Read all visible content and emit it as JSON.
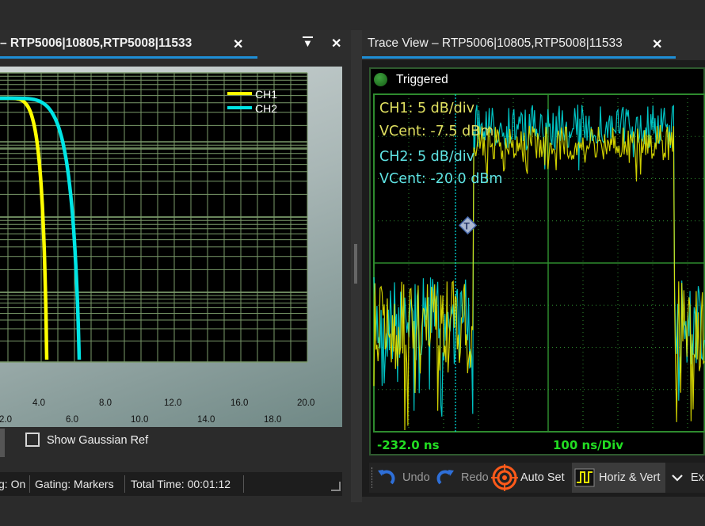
{
  "left_panel": {
    "tab_title": "– RTP5006|10805,RTP5008|11533",
    "close_glyph": "✕",
    "menu_glyph": "▼",
    "panel_close_glyph": "✕",
    "show_gaussian_label": "Show Gaussian Ref",
    "status": {
      "item1": "g: On",
      "item2": "Gating: Markers",
      "item3": "Total Time: 00:01:12"
    }
  },
  "right_panel": {
    "tab_title": "Trace View – RTP5006|10805,RTP5008|11533",
    "close_glyph": "✕",
    "trigger_status": "Triggered",
    "ch1_scale": "CH1: 5 dB/div",
    "ch1_vcent": "VCent: -7.5 dBm",
    "ch2_scale": "CH2: 5 dB/div",
    "ch2_vcent": "VCent: -20.0 dBm",
    "trigger_marker": "T",
    "time_offset": "-232.0 ns",
    "time_div": "100 ns/Div"
  },
  "toolbar": {
    "undo_label": "Undo",
    "redo_label": "Redo",
    "autoset_label": "Auto Set",
    "horizvert_label": "Horiz & Vert",
    "ex_label": "Ex"
  },
  "colors": {
    "ch1": "#ffff00",
    "ch2": "#00e5e5",
    "accent": "#1e8fd6",
    "grid": "#7a9a6a",
    "scope_text_green": "#22dd22"
  },
  "chart_data": {
    "type": "line",
    "legend": [
      "CH1",
      "CH2"
    ],
    "x_ticks_upper": [
      "4.0",
      "8.0",
      "12.0",
      "16.0",
      "20.0"
    ],
    "x_ticks_lower": [
      "2.0",
      "6.0",
      "10.0",
      "14.0",
      "18.0"
    ],
    "xlim": [
      0,
      20
    ],
    "grid": true,
    "legend_position": "top-right"
  }
}
